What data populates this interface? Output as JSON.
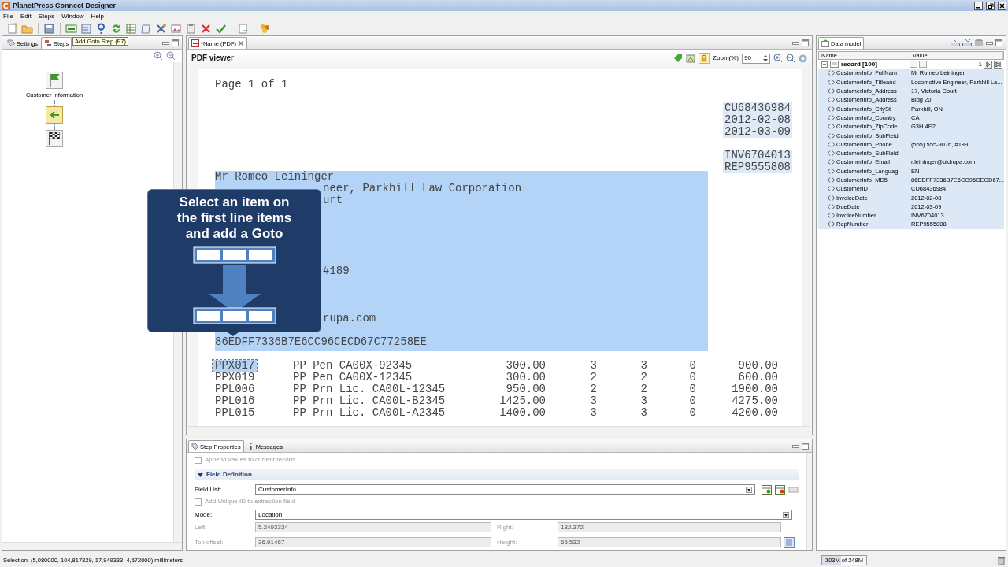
{
  "window": {
    "title": "PlanetPress Connect Designer"
  },
  "menu": [
    "File",
    "Edit",
    "Steps",
    "Window",
    "Help"
  ],
  "tooltip": "Add Goto Step (F7)",
  "left_panel": {
    "tabs": [
      {
        "label": "Settings",
        "selected": false
      },
      {
        "label": "Steps",
        "selected": true
      }
    ],
    "steps": [
      {
        "kind": "start",
        "label": "Customer Information"
      },
      {
        "kind": "goto"
      },
      {
        "kind": "finish"
      }
    ]
  },
  "editor": {
    "tabs": [
      {
        "label": "*Name (PDF)",
        "selected": true
      }
    ],
    "viewer_title": "PDF viewer",
    "zoom_label": "Zoom(%)",
    "zoom": "90",
    "page_label": "Page 1 of 1",
    "header_blocks": [
      {
        "extracted": true,
        "lines": [
          "CU68436984",
          "2012-02-08",
          "2012-03-09"
        ]
      },
      {
        "extracted": true,
        "lines": [
          "INV6704013",
          "REP9555808"
        ]
      }
    ],
    "address": {
      "selected": true,
      "lines": [
        {
          "kind": "full",
          "text": "Mr Romeo Leininger"
        },
        {
          "kind": "partial",
          "text": "neer, Parkhill Law Corporation"
        },
        {
          "kind": "partial",
          "text": "urt"
        },
        {
          "kind": "partial",
          "text": "#189"
        },
        {
          "kind": "partial",
          "text": "rupa.com"
        },
        {
          "kind": "full",
          "text": "86EDFF7336B7E6CC96CECD67C77258EE"
        }
      ]
    },
    "line_items": [
      {
        "selected": true,
        "cells": [
          "PPX017",
          "PP Pen CA00X-92345",
          "300.00",
          "3",
          "3",
          "0",
          "900.00"
        ]
      },
      {
        "selected": false,
        "cells": [
          "PPX019",
          "PP Pen CA00X-12345",
          "300.00",
          "2",
          "2",
          "0",
          "600.00"
        ]
      },
      {
        "selected": false,
        "cells": [
          "PPL006",
          "PP Prn Lic. CA00L-12345",
          "950.00",
          "2",
          "2",
          "0",
          "1900.00"
        ]
      },
      {
        "selected": false,
        "cells": [
          "PPL016",
          "PP Prn Lic. CA00L-B2345",
          "1425.00",
          "3",
          "3",
          "0",
          "4275.00"
        ]
      },
      {
        "selected": false,
        "cells": [
          "PPL015",
          "PP Prn Lic. CA00L-A2345",
          "1400.00",
          "3",
          "3",
          "0",
          "4200.00"
        ]
      }
    ]
  },
  "callout": {
    "text": "Select an item on the first line items and add a Goto"
  },
  "data_model": {
    "title": "Data model",
    "columns": [
      "Name",
      "Value"
    ],
    "record": "record [100]",
    "record_index": "1",
    "fields": [
      {
        "name": "CustomerInfo_FullNam",
        "value": "Mr Romeo Leininger"
      },
      {
        "name": "CustomerInfo_Titleand",
        "value": "Locomotive Engineer, Parkhill La..."
      },
      {
        "name": "CustomerInfo_Address",
        "value": "17, Victoria Court"
      },
      {
        "name": "CustomerInfo_Address",
        "value": "Bldg 20"
      },
      {
        "name": "CustomerInfo_CitySt",
        "value": "Parkhill, ON"
      },
      {
        "name": "CustomerInfo_Country",
        "value": "CA"
      },
      {
        "name": "CustomerInfo_ZipCode",
        "value": "G3H 4E2"
      },
      {
        "name": "CustomerInfo_SubField"
      },
      {
        "name": "CustomerInfo_Phone",
        "value": "(555) 555-9076, #189"
      },
      {
        "name": "CustomerInfo_SubField"
      },
      {
        "name": "CustomerInfo_Email",
        "value": "r.leininger@oldrupa.com"
      },
      {
        "name": "CustomerInfo_Languag",
        "value": "EN"
      },
      {
        "name": "CustomerInfo_MD5",
        "value": "86EDFF7336B7E6CC96CECD67..."
      },
      {
        "name": "CustomerID",
        "value": "CU68436984"
      },
      {
        "name": "InvoiceDate",
        "value": "2012-02-08"
      },
      {
        "name": "DueDate",
        "value": "2012-03-09"
      },
      {
        "name": "InvoiceNumber",
        "value": "INV6704013"
      },
      {
        "name": "RepNumber",
        "value": "REP9555808"
      }
    ]
  },
  "properties": {
    "tabs": [
      {
        "label": "Step Properties",
        "selected": true
      },
      {
        "label": "Messages",
        "selected": false
      }
    ],
    "append": {
      "label": "Append values to current record",
      "checked": false,
      "disabled": true
    },
    "section": {
      "title": "Field Definition",
      "expanded": true
    },
    "field_list": {
      "label": "Field List:",
      "value": "CustomerInfo"
    },
    "unique_id": {
      "label": "Add Unique ID to extraction field",
      "checked": false,
      "disabled": true
    },
    "mode": {
      "label": "Mode:",
      "value": "Location"
    },
    "left": {
      "label": "Left:",
      "value": "5.2493334",
      "disabled": true
    },
    "right": {
      "label": "Right:",
      "value": "182.372",
      "disabled": true
    },
    "top_offset": {
      "label": "Top offset:",
      "value": "36.91467",
      "disabled": true
    },
    "height": {
      "label": "Height:",
      "value": "65.532",
      "disabled": true
    }
  },
  "status_bar": {
    "selection": "Selection: (5,080000, 104,817329, 17,949333, 4,572000) millimeters",
    "memory": "103M of 248M",
    "level": 0.42
  }
}
